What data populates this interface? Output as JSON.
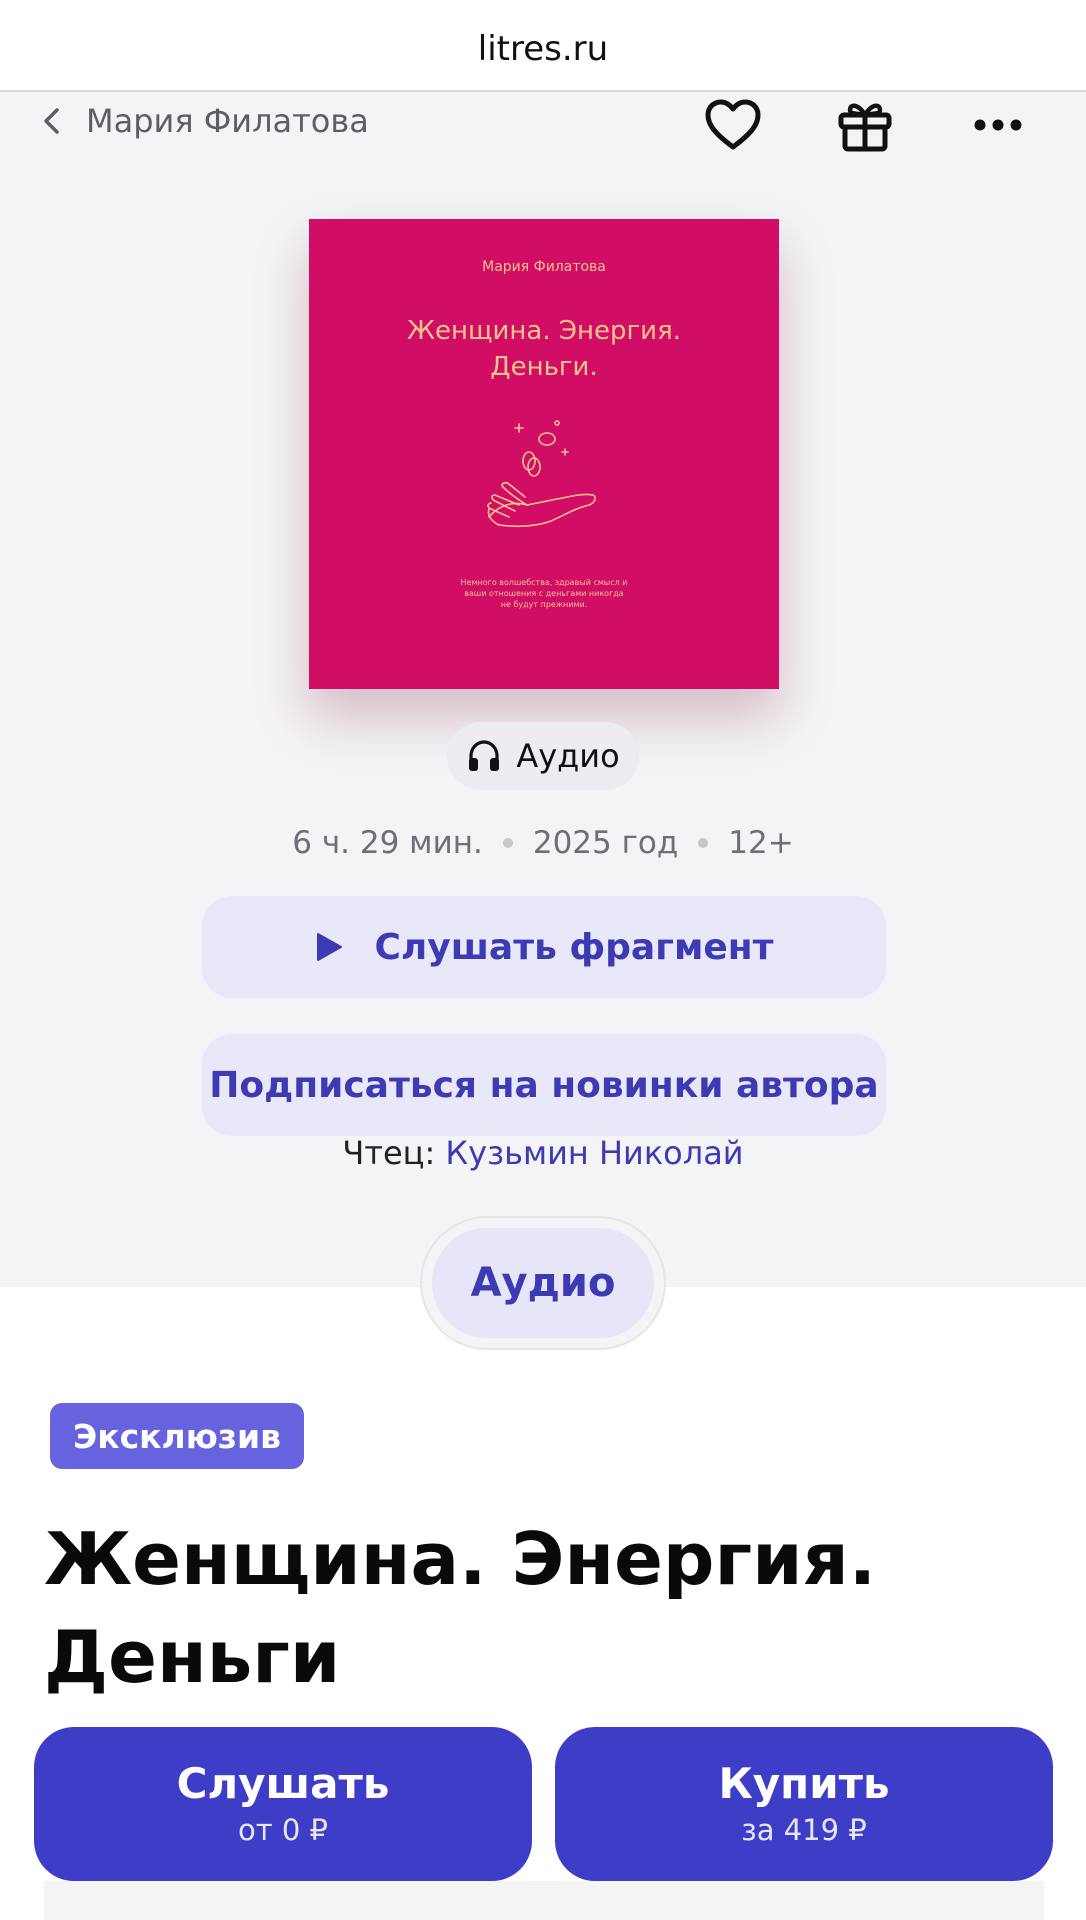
{
  "browser": {
    "url": "litres.ru"
  },
  "nav": {
    "back_label": "Мария Филатова",
    "icons": [
      "heart-icon",
      "gift-icon",
      "more-icon"
    ]
  },
  "cover": {
    "author": "Мария Филатова",
    "title": "Женщина. Энергия. Деньги.",
    "blurb": "Немного волшебства, здравый смысл и ваши отношения с деньгами никогда не будут прежними."
  },
  "format_chip": {
    "label": "Аудио",
    "icon": "headphones-icon"
  },
  "meta": {
    "duration": "6 ч. 29 мин.",
    "year": "2025 год",
    "age": "12+"
  },
  "buttons": {
    "listen_fragment": "Слушать фрагмент",
    "subscribe": "Подписаться на новинки автора"
  },
  "reader": {
    "label": "Чтец:",
    "name": "Кузьмин Николай"
  },
  "tabs": {
    "active": "Аудио"
  },
  "badge": "Эксклюзив",
  "book": {
    "title": "Женщина. Энергия. Деньги"
  },
  "cta": {
    "listen": {
      "label": "Слушать",
      "sub": "от 0 ₽"
    },
    "buy": {
      "label": "Купить",
      "sub": "за 419 ₽"
    }
  },
  "colors": {
    "accent": "#3d3dc8",
    "cover": "#d10d66",
    "badge": "#6763de"
  }
}
